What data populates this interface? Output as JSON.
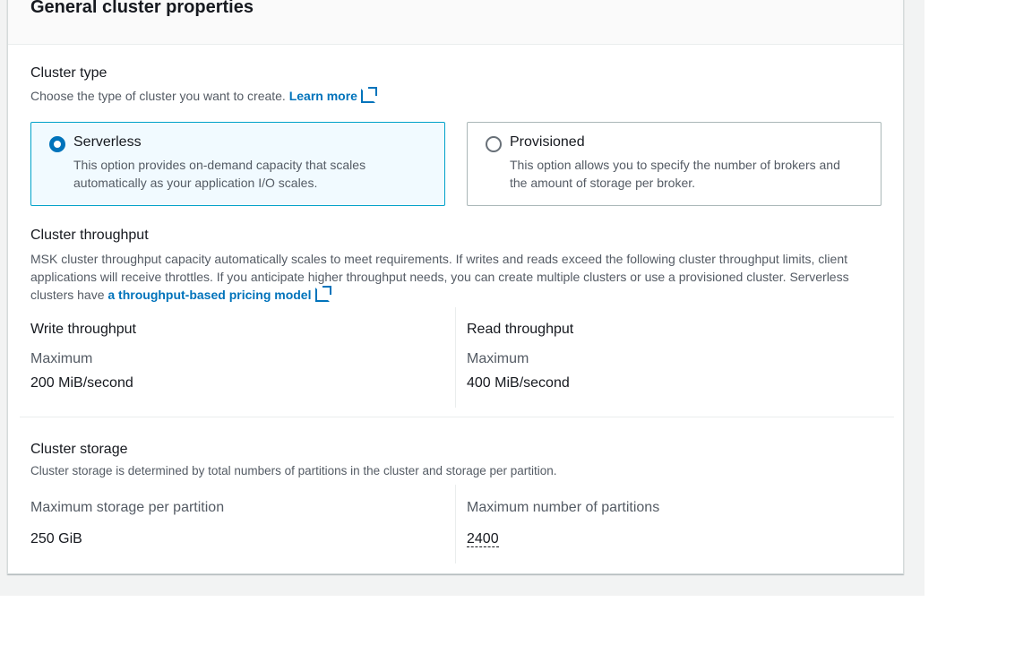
{
  "title": "General cluster properties",
  "cluster_type": {
    "label": "Cluster type",
    "description": "Choose the type of cluster you want to create.",
    "learn_more": "Learn more",
    "options": [
      {
        "label": "Serverless",
        "description": "This option provides on-demand capacity that scales automatically as your application I/O scales.",
        "selected": true
      },
      {
        "label": "Provisioned",
        "description": "This option allows you to specify the number of brokers and the amount of storage per broker.",
        "selected": false
      }
    ]
  },
  "throughput": {
    "label": "Cluster throughput",
    "description": "MSK cluster throughput capacity automatically scales to meet requirements. If writes and reads exceed the following cluster throughput limits, client applications will receive throttles. If you anticipate higher throughput needs, you can create multiple clusters or use a provisioned cluster. Serverless clusters have",
    "pricing_link": "a throughput-based pricing model",
    "write": {
      "label": "Write throughput",
      "sub": "Maximum",
      "value": "200 MiB/second"
    },
    "read": {
      "label": "Read throughput",
      "sub": "Maximum",
      "value": "400 MiB/second"
    }
  },
  "storage": {
    "label": "Cluster storage",
    "description": "Cluster storage is determined by total numbers of partitions in the cluster and storage per partition.",
    "per_partition": {
      "label": "Maximum storage per partition",
      "value": "250 GiB"
    },
    "partitions": {
      "label": "Maximum number of partitions",
      "value": "2400"
    }
  }
}
